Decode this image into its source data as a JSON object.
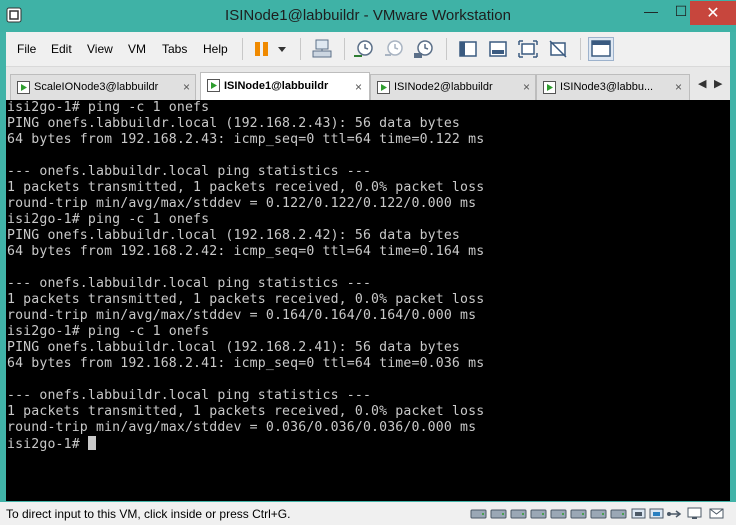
{
  "window": {
    "title": "ISINode1@labbuildr - VMware Workstation",
    "min_glyph": "—",
    "max_glyph": "☐",
    "close_glyph": "✕"
  },
  "menu": {
    "items": [
      "File",
      "Edit",
      "View",
      "VM",
      "Tabs",
      "Help"
    ]
  },
  "toolbar": {
    "icons": [
      "pause-icon",
      "dropdown-arrow-icon",
      "send-ctrl-alt-del-icon",
      "snapshot-icon",
      "revert-snapshot-icon",
      "snapshot-manager-icon",
      "show-library-icon",
      "quick-switch-icon",
      "full-screen-icon",
      "unity-icon",
      "console-view-icon"
    ]
  },
  "tabs": [
    {
      "label": "ScaleIONode3@labbuildr",
      "active": false,
      "close": "×"
    },
    {
      "label": "ISINode1@labbuildr",
      "active": true,
      "close": "×"
    },
    {
      "label": "ISINode2@labbuildr",
      "active": false,
      "close": "×"
    },
    {
      "label": "ISINode3@labbu...",
      "active": false,
      "close": "×"
    }
  ],
  "tab_nav": {
    "prev": "◀",
    "next": "▶"
  },
  "terminal": {
    "lines": [
      "isi2go-1# ping -c 1 onefs",
      "PING onefs.labbuildr.local (192.168.2.43): 56 data bytes",
      "64 bytes from 192.168.2.43: icmp_seq=0 ttl=64 time=0.122 ms",
      "",
      "--- onefs.labbuildr.local ping statistics ---",
      "1 packets transmitted, 1 packets received, 0.0% packet loss",
      "round-trip min/avg/max/stddev = 0.122/0.122/0.122/0.000 ms",
      "isi2go-1# ping -c 1 onefs",
      "PING onefs.labbuildr.local (192.168.2.42): 56 data bytes",
      "64 bytes from 192.168.2.42: icmp_seq=0 ttl=64 time=0.164 ms",
      "",
      "--- onefs.labbuildr.local ping statistics ---",
      "1 packets transmitted, 1 packets received, 0.0% packet loss",
      "round-trip min/avg/max/stddev = 0.164/0.164/0.164/0.000 ms",
      "isi2go-1# ping -c 1 onefs",
      "PING onefs.labbuildr.local (192.168.2.41): 56 data bytes",
      "64 bytes from 192.168.2.41: icmp_seq=0 ttl=64 time=0.036 ms",
      "",
      "--- onefs.labbuildr.local ping statistics ---",
      "1 packets transmitted, 1 packets received, 0.0% packet loss",
      "round-trip min/avg/max/stddev = 0.036/0.036/0.036/0.000 ms",
      "isi2go-1# "
    ]
  },
  "status": {
    "text": "To direct input to this VM, click inside or press Ctrl+G.",
    "devices": [
      "hard-disk-icon",
      "hard-disk-icon",
      "hard-disk-icon",
      "hard-disk-icon",
      "hard-disk-icon",
      "hard-disk-icon",
      "hard-disk-icon",
      "hard-disk-icon",
      "network-adapter-icon",
      "network-adapter-icon",
      "usb-icon",
      "display-icon",
      "message-icon"
    ]
  },
  "colors": {
    "title_bar": "#3fb2a6",
    "close_button": "#c7463d",
    "terminal_bg": "#000000",
    "terminal_fg": "#c9c9c9"
  }
}
